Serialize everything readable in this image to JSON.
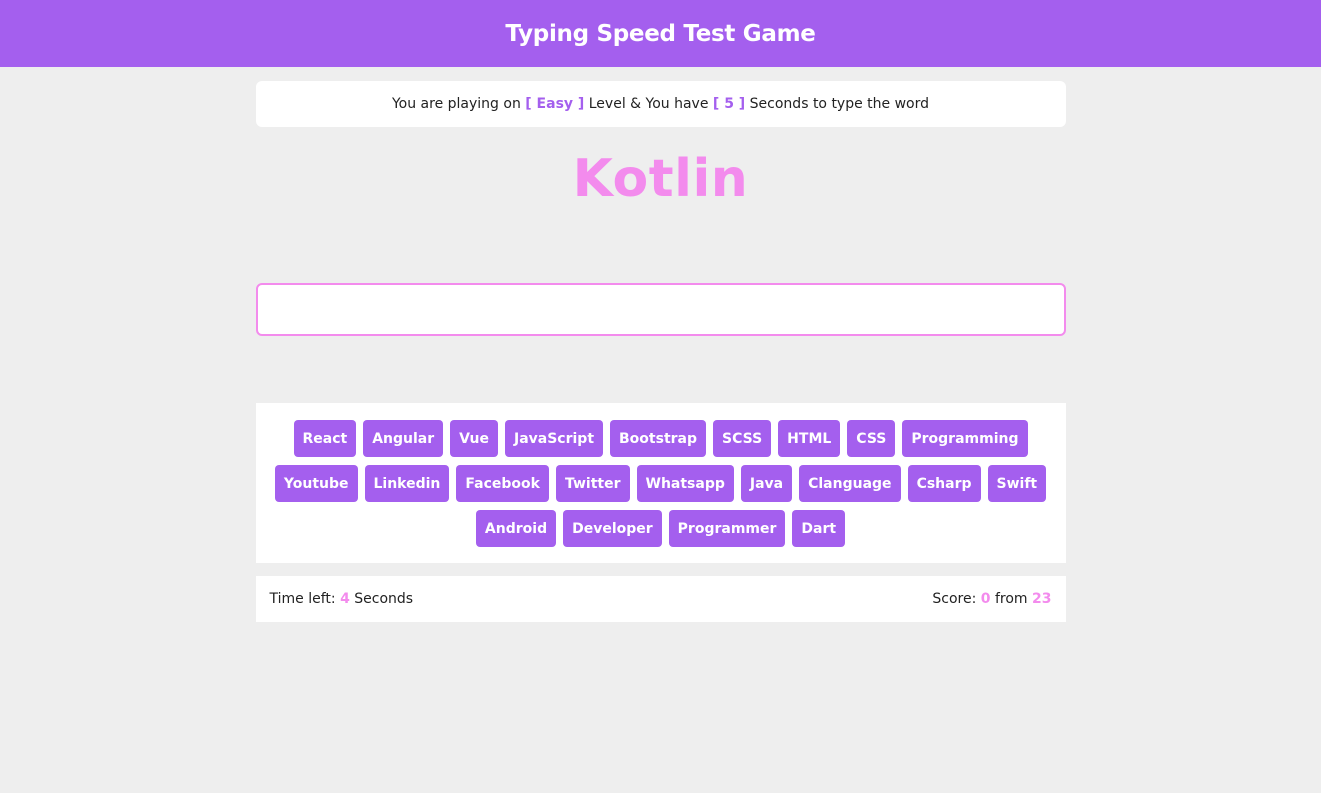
{
  "header": {
    "title": "Typing Speed Test Game"
  },
  "message": {
    "prefix": "You are playing on",
    "level": "[ Easy ]",
    "middle": "Level & You have",
    "seconds": "[ 5 ]",
    "suffix": "Seconds to type the word"
  },
  "current_word": "Kotlin",
  "input": {
    "value": "",
    "placeholder": ""
  },
  "words": [
    "React",
    "Angular",
    "Vue",
    "JavaScript",
    "Bootstrap",
    "SCSS",
    "HTML",
    "CSS",
    "Programming",
    "Youtube",
    "Linkedin",
    "Facebook",
    "Twitter",
    "Whatsapp",
    "Java",
    "Clanguage",
    "Csharp",
    "Swift",
    "Android",
    "Developer",
    "Programmer",
    "Dart"
  ],
  "controls": {
    "time_label": "Time left:",
    "time_value": "4",
    "time_unit": "Seconds",
    "score_label": "Score:",
    "score_value": "0",
    "score_from": "from",
    "score_total": "23"
  },
  "colors": {
    "primary": "#a45fee",
    "accent": "#f38bed",
    "background": "#eeeeee"
  }
}
